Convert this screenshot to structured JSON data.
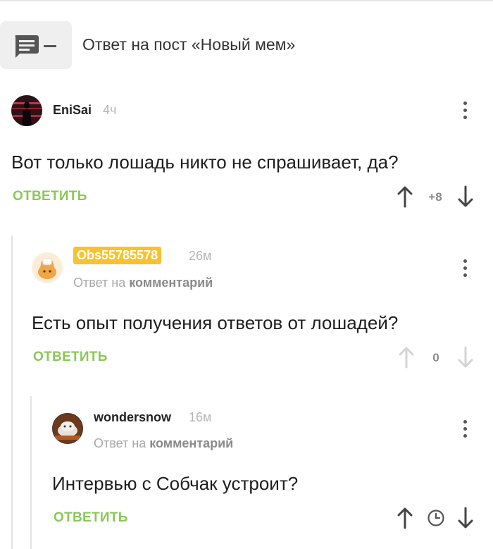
{
  "post": {
    "title": "Ответ на пост «Новый мем»",
    "icon": "comment-icon"
  },
  "comments": [
    {
      "author": "EniSai",
      "time": "4ч",
      "reply_note": "",
      "text": "Вот только лошадь никто не спрашивает, да?",
      "reply_label": "ОТВЕТИТЬ",
      "rating": "+8",
      "avatar": "avatar-dark-figure"
    },
    {
      "author": "Obs55785578",
      "time": "26м",
      "reply_note_prefix": "Ответ на",
      "reply_note_target": "комментарий",
      "text": "Есть опыт получения ответов от лошадей?",
      "reply_label": "ОТВЕТИТЬ",
      "rating": "0",
      "avatar": "avatar-orange-cat"
    },
    {
      "author": "wondersnow",
      "time": "16м",
      "reply_note_prefix": "Ответ на",
      "reply_note_target": "комментарий",
      "text": "Интервью с Собчак устроит?",
      "reply_label": "ОТВЕТИТЬ",
      "rating_icon": "clock-icon",
      "avatar": "avatar-snowy-cat"
    }
  ],
  "colors": {
    "accent_green": "#8ac858",
    "badge_yellow": "#f9c12c",
    "muted": "#b5b5b5"
  }
}
